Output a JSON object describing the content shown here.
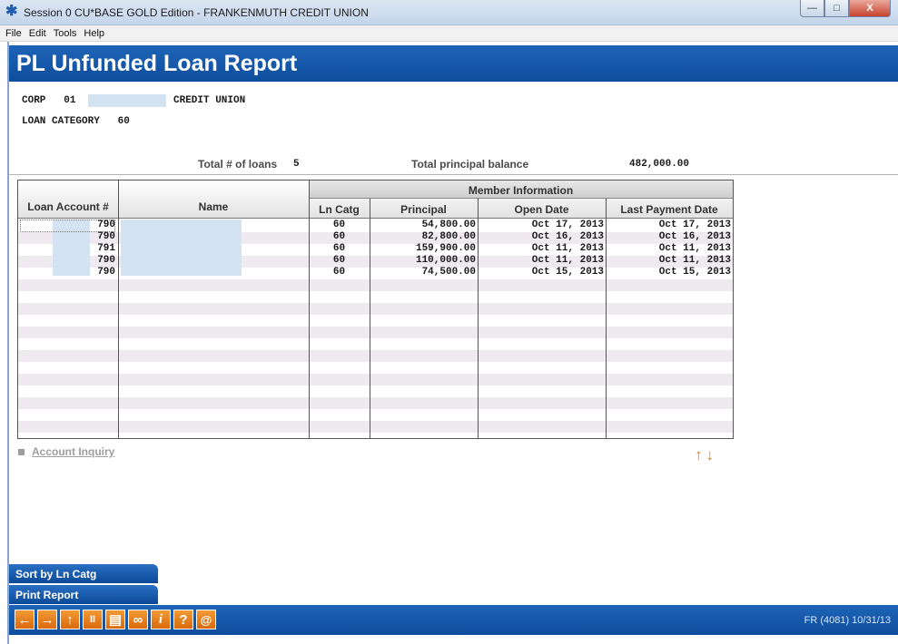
{
  "window": {
    "title": "Session 0 CU*BASE GOLD Edition - FRANKENMUTH CREDIT UNION",
    "controls": {
      "minimize": "—",
      "maximize": "□",
      "close": "X"
    }
  },
  "menu": [
    "File",
    "Edit",
    "Tools",
    "Help"
  ],
  "page_title": "PL Unfunded Loan Report",
  "header": {
    "corp_label": "CORP",
    "corp_value": "01",
    "corp_name_suffix": "CREDIT UNION",
    "loan_category_label": "LOAN CATEGORY",
    "loan_category_value": "60",
    "total_loans_label": "Total # of loans",
    "total_loans_value": "5",
    "total_principal_label": "Total principal balance",
    "total_principal_value": "482,000.00"
  },
  "table": {
    "group_header": "Member Information",
    "columns": [
      "Loan Account #",
      "Name",
      "Ln Catg",
      "Principal",
      "Open Date",
      "Last Payment Date"
    ],
    "rows": [
      {
        "account": "790",
        "name": "",
        "ln_catg": "60",
        "principal": "54,800.00",
        "open_date": "Oct 17, 2013",
        "last_payment": "Oct 17, 2013"
      },
      {
        "account": "790",
        "name": "",
        "ln_catg": "60",
        "principal": "82,800.00",
        "open_date": "Oct 16, 2013",
        "last_payment": "Oct 16, 2013"
      },
      {
        "account": "791",
        "name": "",
        "ln_catg": "60",
        "principal": "159,900.00",
        "open_date": "Oct 11, 2013",
        "last_payment": "Oct 11, 2013"
      },
      {
        "account": "790",
        "name": "",
        "ln_catg": "60",
        "principal": "110,000.00",
        "open_date": "Oct 11, 2013",
        "last_payment": "Oct 11, 2013"
      },
      {
        "account": "790",
        "name": "",
        "ln_catg": "60",
        "principal": "74,500.00",
        "open_date": "Oct 15, 2013",
        "last_payment": "Oct 15, 2013"
      }
    ]
  },
  "actions": {
    "account_inquiry": "Account Inquiry",
    "scroll_up": "↑",
    "scroll_down": "↓"
  },
  "function_keys": {
    "sort_by_ln_catg": "Sort by Ln Catg",
    "print_report": "Print Report"
  },
  "toolbar": {
    "icons": [
      "back-icon",
      "forward-icon",
      "up-icon",
      "pause-icon",
      "print-icon",
      "link-icon",
      "info-icon",
      "help-icon",
      "email-icon"
    ],
    "glyphs": {
      "back": "←",
      "forward": "→",
      "up": "↑",
      "pause": "II",
      "print": "▤",
      "link": "∞",
      "info": "i",
      "help": "?",
      "email": "@"
    },
    "status_text": "FR (4081) 10/31/13"
  },
  "colors": {
    "brand_blue": "#0d4d9d",
    "accent_orange": "#e07b18",
    "row_alt": "#eeeaf0",
    "mask": "#d4e3f2"
  }
}
